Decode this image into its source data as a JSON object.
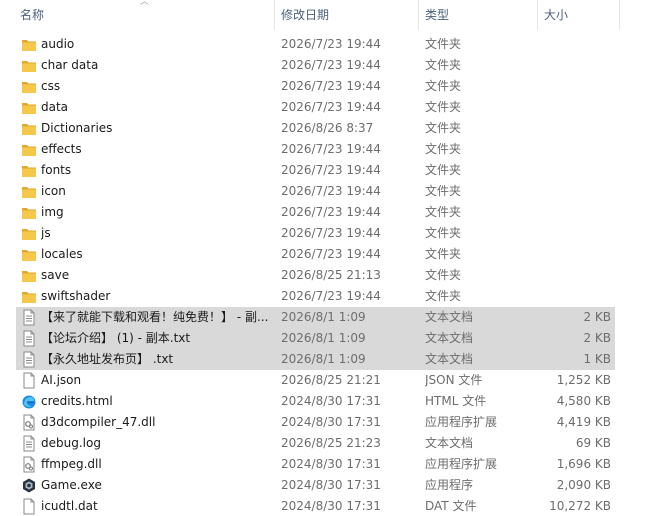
{
  "columns": {
    "name": "名称",
    "date": "修改日期",
    "type": "类型",
    "size": "大小"
  },
  "colors": {
    "folder": "#f5c84c",
    "selection": "#d9d9d9",
    "header_text": "#4c607a"
  },
  "files": [
    {
      "name": "audio",
      "date": "2026/7/23 19:44",
      "type": "文件夹",
      "size": "",
      "icon": "folder-icon",
      "selected": false
    },
    {
      "name": "char data",
      "date": "2026/7/23 19:44",
      "type": "文件夹",
      "size": "",
      "icon": "folder-icon",
      "selected": false
    },
    {
      "name": "css",
      "date": "2026/7/23 19:44",
      "type": "文件夹",
      "size": "",
      "icon": "folder-icon",
      "selected": false
    },
    {
      "name": "data",
      "date": "2026/7/23 19:44",
      "type": "文件夹",
      "size": "",
      "icon": "folder-icon",
      "selected": false
    },
    {
      "name": "Dictionaries",
      "date": "2026/8/26 8:37",
      "type": "文件夹",
      "size": "",
      "icon": "folder-icon",
      "selected": false
    },
    {
      "name": "effects",
      "date": "2026/7/23 19:44",
      "type": "文件夹",
      "size": "",
      "icon": "folder-icon",
      "selected": false
    },
    {
      "name": "fonts",
      "date": "2026/7/23 19:44",
      "type": "文件夹",
      "size": "",
      "icon": "folder-icon",
      "selected": false
    },
    {
      "name": "icon",
      "date": "2026/7/23 19:44",
      "type": "文件夹",
      "size": "",
      "icon": "folder-icon",
      "selected": false
    },
    {
      "name": "img",
      "date": "2026/7/23 19:44",
      "type": "文件夹",
      "size": "",
      "icon": "folder-icon",
      "selected": false
    },
    {
      "name": "js",
      "date": "2026/7/23 19:44",
      "type": "文件夹",
      "size": "",
      "icon": "folder-icon",
      "selected": false
    },
    {
      "name": "locales",
      "date": "2026/7/23 19:44",
      "type": "文件夹",
      "size": "",
      "icon": "folder-icon",
      "selected": false
    },
    {
      "name": "save",
      "date": "2026/8/25 21:13",
      "type": "文件夹",
      "size": "",
      "icon": "folder-icon",
      "selected": false
    },
    {
      "name": "swiftshader",
      "date": "2026/7/23 19:44",
      "type": "文件夹",
      "size": "",
      "icon": "folder-icon",
      "selected": false
    },
    {
      "name": "【来了就能下载和观看！纯免费！】 - 副...",
      "date": "2026/8/1 1:09",
      "type": "文本文档",
      "size": "2 KB",
      "icon": "text-file-icon",
      "selected": true
    },
    {
      "name": "【论坛介绍】 (1) - 副本.txt",
      "date": "2026/8/1 1:09",
      "type": "文本文档",
      "size": "2 KB",
      "icon": "text-file-icon",
      "selected": true
    },
    {
      "name": "【永久地址发布页】 .txt",
      "date": "2026/8/1 1:09",
      "type": "文本文档",
      "size": "1 KB",
      "icon": "text-file-icon",
      "selected": true
    },
    {
      "name": "AI.json",
      "date": "2026/8/25 21:21",
      "type": "JSON 文件",
      "size": "1,252 KB",
      "icon": "blank-file-icon",
      "selected": false
    },
    {
      "name": "credits.html",
      "date": "2024/8/30 17:31",
      "type": "HTML 文件",
      "size": "4,580 KB",
      "icon": "edge-html-icon",
      "selected": false
    },
    {
      "name": "d3dcompiler_47.dll",
      "date": "2024/8/30 17:31",
      "type": "应用程序扩展",
      "size": "4,419 KB",
      "icon": "dll-file-icon",
      "selected": false
    },
    {
      "name": "debug.log",
      "date": "2026/8/25 21:23",
      "type": "文本文档",
      "size": "69 KB",
      "icon": "text-file-icon",
      "selected": false
    },
    {
      "name": "ffmpeg.dll",
      "date": "2024/8/30 17:31",
      "type": "应用程序扩展",
      "size": "1,696 KB",
      "icon": "dll-file-icon",
      "selected": false
    },
    {
      "name": "Game.exe",
      "date": "2024/8/30 17:31",
      "type": "应用程序",
      "size": "2,090 KB",
      "icon": "game-exe-icon",
      "selected": false
    },
    {
      "name": "icudtl.dat",
      "date": "2024/8/30 17:31",
      "type": "DAT 文件",
      "size": "10,272 KB",
      "icon": "blank-file-icon",
      "selected": false
    }
  ]
}
